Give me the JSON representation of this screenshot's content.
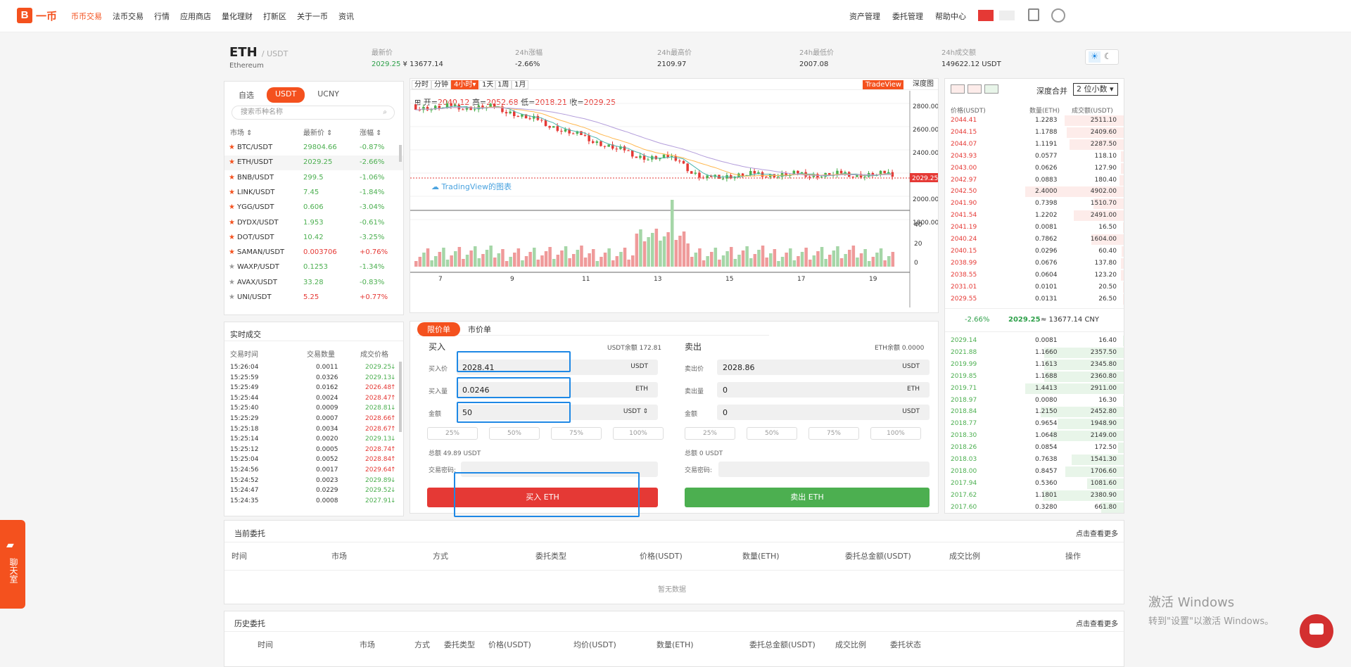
{
  "nav": {
    "logo_mark": "B",
    "logo_text": "一币",
    "items": [
      {
        "label": "币币交易",
        "active": true
      },
      {
        "label": "法币交易",
        "active": false
      },
      {
        "label": "行情",
        "active": false
      },
      {
        "label": "应用商店",
        "active": false
      },
      {
        "label": "量化理财",
        "active": false
      },
      {
        "label": "打新区",
        "active": false
      },
      {
        "label": "关于一币",
        "active": false
      },
      {
        "label": "资讯",
        "active": false
      }
    ],
    "right": [
      "资产管理",
      "委托管理",
      "帮助中心"
    ]
  },
  "ticker": {
    "pair": "ETH",
    "quote": "/ USDT",
    "name": "Ethereum",
    "last_label": "最新价",
    "last_price": "2029.25",
    "last_cny": "¥ 13677.14",
    "change_label": "24h涨幅",
    "change": "-2.66%",
    "high_label": "24h最高价",
    "high": "2109.97",
    "low_label": "24h最低价",
    "low": "2007.08",
    "vol_label": "24h成交额",
    "vol": "149622.12 USDT"
  },
  "market": {
    "tabs": [
      "自选",
      "USDT",
      "UCNY"
    ],
    "search_placeholder": "搜索币种名称",
    "headers": [
      "市场 ⇕",
      "最新价 ⇕",
      "涨幅 ⇕"
    ],
    "rows": [
      {
        "pair": "BTC/USDT",
        "price": "29804.66",
        "change": "-0.87%",
        "dir": "dn",
        "fav": true
      },
      {
        "pair": "ETH/USDT",
        "price": "2029.25",
        "change": "-2.66%",
        "dir": "dn",
        "fav": true
      },
      {
        "pair": "BNB/USDT",
        "price": "299.5",
        "change": "-1.06%",
        "dir": "dn",
        "fav": true
      },
      {
        "pair": "LINK/USDT",
        "price": "7.45",
        "change": "-1.84%",
        "dir": "dn",
        "fav": true
      },
      {
        "pair": "YGG/USDT",
        "price": "0.606",
        "change": "-3.04%",
        "dir": "dn",
        "fav": true
      },
      {
        "pair": "DYDX/USDT",
        "price": "1.953",
        "change": "-0.61%",
        "dir": "dn",
        "fav": true
      },
      {
        "pair": "DOT/USDT",
        "price": "10.42",
        "change": "-3.25%",
        "dir": "dn",
        "fav": true
      },
      {
        "pair": "SAMAN/USDT",
        "price": "0.003706",
        "change": "+0.76%",
        "dir": "up",
        "fav": true
      },
      {
        "pair": "WAXP/USDT",
        "price": "0.1253",
        "change": "-1.34%",
        "dir": "dn",
        "fav": false
      },
      {
        "pair": "AVAX/USDT",
        "price": "33.28",
        "change": "-0.83%",
        "dir": "dn",
        "fav": false
      },
      {
        "pair": "UNI/USDT",
        "price": "5.25",
        "change": "+0.77%",
        "dir": "up",
        "fav": false
      }
    ]
  },
  "trades": {
    "title": "实时成交",
    "headers": [
      "交易时间",
      "交易数量",
      "成交价格"
    ],
    "rows": [
      {
        "time": "15:26:04",
        "qty": "0.0011",
        "price": "2029.25",
        "dir": "dn"
      },
      {
        "time": "15:25:59",
        "qty": "0.0326",
        "price": "2029.13",
        "dir": "dn"
      },
      {
        "time": "15:25:49",
        "qty": "0.0162",
        "price": "2026.48",
        "dir": "up"
      },
      {
        "time": "15:25:44",
        "qty": "0.0024",
        "price": "2028.47",
        "dir": "up"
      },
      {
        "time": "15:25:40",
        "qty": "0.0009",
        "price": "2028.81",
        "dir": "dn"
      },
      {
        "time": "15:25:29",
        "qty": "0.0007",
        "price": "2028.66",
        "dir": "up"
      },
      {
        "time": "15:25:18",
        "qty": "0.0034",
        "price": "2028.67",
        "dir": "up"
      },
      {
        "time": "15:25:14",
        "qty": "0.0020",
        "price": "2029.13",
        "dir": "dn"
      },
      {
        "time": "15:25:12",
        "qty": "0.0005",
        "price": "2028.74",
        "dir": "up"
      },
      {
        "time": "15:25:04",
        "qty": "0.0052",
        "price": "2028.84",
        "dir": "up"
      },
      {
        "time": "15:24:56",
        "qty": "0.0017",
        "price": "2029.64",
        "dir": "up"
      },
      {
        "time": "15:24:52",
        "qty": "0.0023",
        "price": "2029.89",
        "dir": "dn"
      },
      {
        "time": "15:24:47",
        "qty": "0.0229",
        "price": "2029.52",
        "dir": "dn"
      },
      {
        "time": "15:24:35",
        "qty": "0.0008",
        "price": "2027.91",
        "dir": "dn"
      }
    ]
  },
  "chart": {
    "tabs": [
      "分时",
      "分钟",
      "4小时▾",
      "1天",
      "1周",
      "1月"
    ],
    "tradeview": "TradeView",
    "depth": "深度图",
    "ohlc": {
      "o_label": "开=",
      "o": "2040.12",
      "h_label": "高=",
      "h": "2052.68",
      "l_label": "低=",
      "l": "2018.21",
      "c_label": "收=",
      "c": "2029.25"
    },
    "price_ticks": [
      "2800.00",
      "2600.00",
      "2400.00",
      "2200.00",
      "2000.00",
      "1800.00"
    ],
    "current_price_tag": "2029.25",
    "vol_ticks": [
      "40",
      "20",
      "0"
    ],
    "x_ticks": [
      "7",
      "9",
      "11",
      "13",
      "15",
      "17",
      "19"
    ],
    "watermark": "TradingView的图表"
  },
  "order": {
    "tabs": [
      "限价单",
      "市价单"
    ],
    "buy": {
      "title": "买入",
      "balance": "USDT余额 172.81",
      "price_label": "买入价",
      "price": "2028.41",
      "price_unit": "USDT",
      "qty_label": "买入量",
      "qty": "0.0246",
      "qty_unit": "ETH",
      "amt_label": "金额",
      "amt": "50",
      "amt_unit": "USDT ⇕",
      "total": "总额 49.89 USDT",
      "pwd_label": "交易密码:",
      "button": "买入 ETH"
    },
    "sell": {
      "title": "卖出",
      "balance": "ETH余额 0.0000",
      "price_label": "卖出价",
      "price": "2028.86",
      "price_unit": "USDT",
      "qty_label": "卖出量",
      "qty": "0",
      "qty_unit": "ETH",
      "amt_label": "金额",
      "amt": "0",
      "amt_unit": "USDT",
      "total": "总额 0 USDT",
      "pwd_label": "交易密码:",
      "button": "卖出 ETH"
    },
    "pcts": [
      "25%",
      "50%",
      "75%",
      "100%"
    ]
  },
  "orderbook": {
    "depth_label": "深度合并",
    "depth_select": "2 位小数",
    "headers": [
      "价格(USDT)",
      "数量(ETH)",
      "成交额(USDT)"
    ],
    "asks": [
      {
        "p": "2044.41",
        "q": "1.2283",
        "t": "2511.10",
        "w": 0.6
      },
      {
        "p": "2044.15",
        "q": "1.1788",
        "t": "2409.60",
        "w": 0.58
      },
      {
        "p": "2044.07",
        "q": "1.1191",
        "t": "2287.50",
        "w": 0.55
      },
      {
        "p": "2043.93",
        "q": "0.0577",
        "t": "118.10",
        "w": 0.03
      },
      {
        "p": "2043.00",
        "q": "0.0626",
        "t": "127.90",
        "w": 0.03
      },
      {
        "p": "2042.97",
        "q": "0.0883",
        "t": "180.40",
        "w": 0.04
      },
      {
        "p": "2042.50",
        "q": "2.4000",
        "t": "4902.00",
        "w": 1.0
      },
      {
        "p": "2041.90",
        "q": "0.7398",
        "t": "1510.70",
        "w": 0.31
      },
      {
        "p": "2041.54",
        "q": "1.2202",
        "t": "2491.00",
        "w": 0.51
      },
      {
        "p": "2041.19",
        "q": "0.0081",
        "t": "16.50",
        "w": 0.01
      },
      {
        "p": "2040.24",
        "q": "0.7862",
        "t": "1604.00",
        "w": 0.33
      },
      {
        "p": "2040.15",
        "q": "0.0296",
        "t": "60.40",
        "w": 0.02
      },
      {
        "p": "2038.99",
        "q": "0.0676",
        "t": "137.80",
        "w": 0.03
      },
      {
        "p": "2038.55",
        "q": "0.0604",
        "t": "123.20",
        "w": 0.03
      },
      {
        "p": "2031.01",
        "q": "0.0101",
        "t": "20.50",
        "w": 0.01
      },
      {
        "p": "2029.55",
        "q": "0.0131",
        "t": "26.50",
        "w": 0.01
      }
    ],
    "mid": {
      "change": "-2.66%",
      "price": "2029.25",
      "cny": "≈ 13677.14 CNY"
    },
    "bids": [
      {
        "p": "2029.14",
        "q": "0.0081",
        "t": "16.40",
        "w": 0.01
      },
      {
        "p": "2021.88",
        "q": "1.1660",
        "t": "2357.50",
        "w": 0.81
      },
      {
        "p": "2019.99",
        "q": "1.1613",
        "t": "2345.80",
        "w": 0.81
      },
      {
        "p": "2019.85",
        "q": "1.1688",
        "t": "2360.80",
        "w": 0.81
      },
      {
        "p": "2019.71",
        "q": "1.4413",
        "t": "2911.00",
        "w": 1.0
      },
      {
        "p": "2018.97",
        "q": "0.0080",
        "t": "16.30",
        "w": 0.01
      },
      {
        "p": "2018.84",
        "q": "1.2150",
        "t": "2452.80",
        "w": 0.84
      },
      {
        "p": "2018.77",
        "q": "0.9654",
        "t": "1948.90",
        "w": 0.67
      },
      {
        "p": "2018.30",
        "q": "1.0648",
        "t": "2149.00",
        "w": 0.74
      },
      {
        "p": "2018.26",
        "q": "0.0854",
        "t": "172.50",
        "w": 0.06
      },
      {
        "p": "2018.03",
        "q": "0.7638",
        "t": "1541.30",
        "w": 0.53
      },
      {
        "p": "2018.00",
        "q": "0.8457",
        "t": "1706.60",
        "w": 0.59
      },
      {
        "p": "2017.94",
        "q": "0.5360",
        "t": "1081.60",
        "w": 0.37
      },
      {
        "p": "2017.62",
        "q": "1.1801",
        "t": "2380.90",
        "w": 0.82
      },
      {
        "p": "2017.60",
        "q": "0.3280",
        "t": "661.80",
        "w": 0.23
      }
    ]
  },
  "current_orders": {
    "title": "当前委托",
    "more": "点击查看更多",
    "headers": [
      "时间",
      "市场",
      "方式",
      "委托类型",
      "价格(USDT)",
      "数量(ETH)",
      "委托总金额(USDT)",
      "成交比例",
      "操作"
    ],
    "empty": "暂无数据"
  },
  "history_orders": {
    "title": "历史委托",
    "more": "点击查看更多",
    "headers": [
      "时间",
      "市场",
      "方式",
      "委托类型",
      "价格(USDT)",
      "均价(USDT)",
      "数量(ETH)",
      "委托总金额(USDT)",
      "成交比例",
      "委托状态"
    ]
  },
  "chat_label": "聊天室",
  "windows": {
    "line1": "激活 Windows",
    "line2": "转到\"设置\"以激活 Windows。"
  },
  "colors": {
    "accent": "#f4511e",
    "buy": "#e53935",
    "sell": "#4caf50",
    "highlight": "#1e88e5"
  }
}
